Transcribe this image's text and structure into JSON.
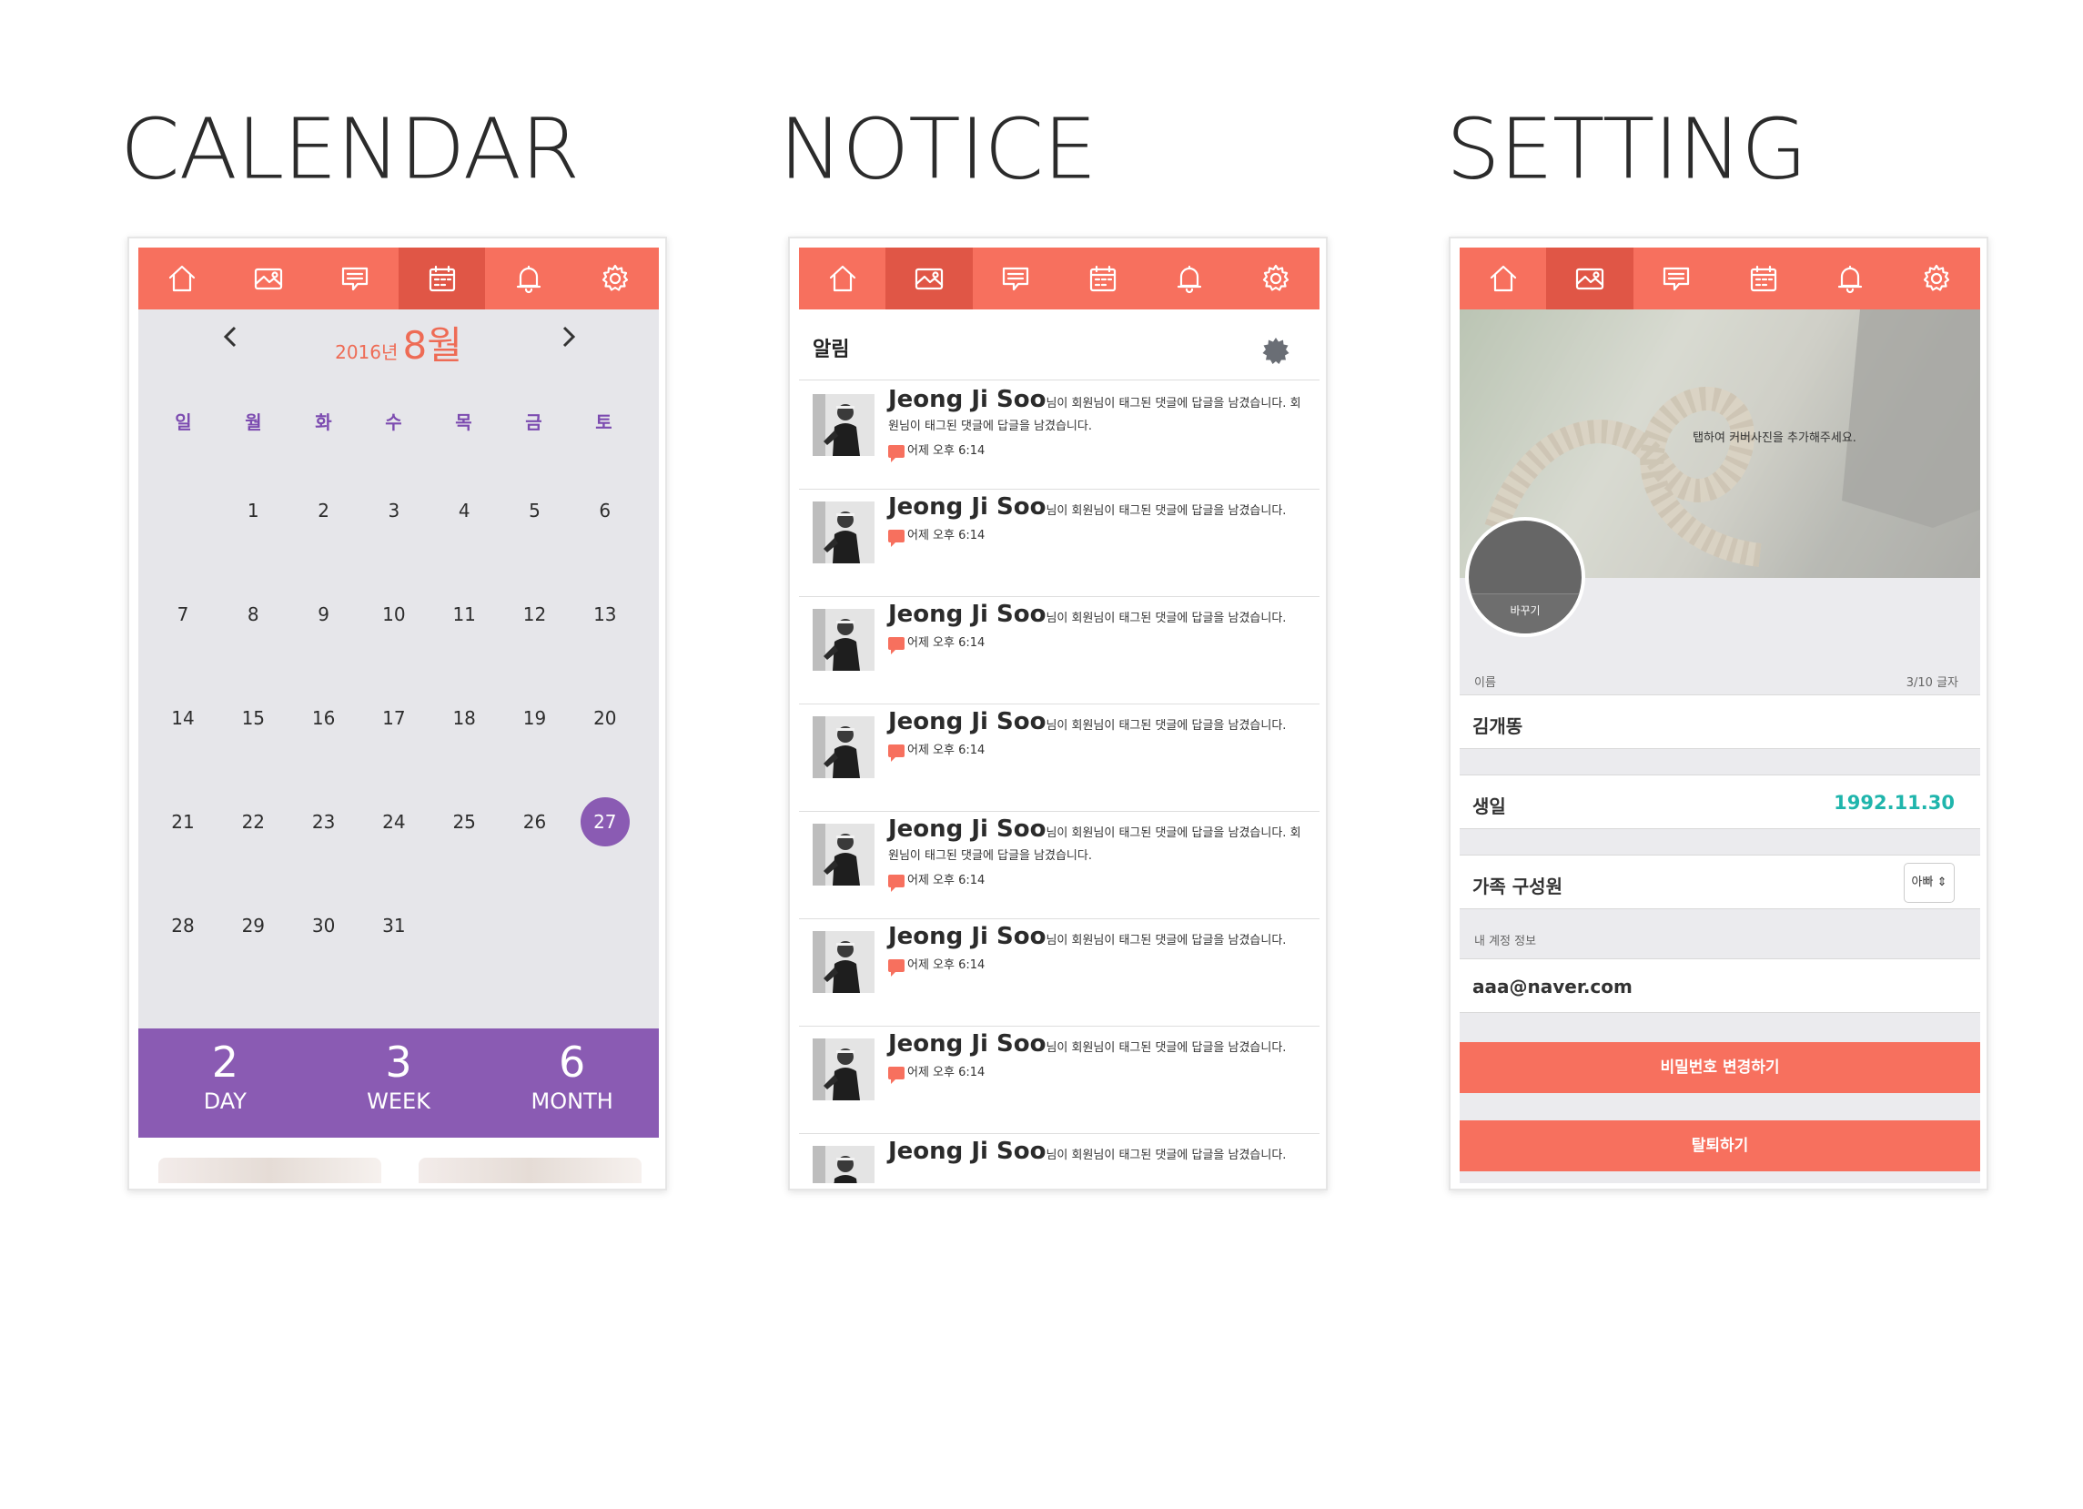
{
  "sections": {
    "calendar_title": "CALENDAR",
    "notice_title": "NOTICE",
    "setting_title": "SETTING"
  },
  "nav_icons": [
    "home-icon",
    "photo-icon",
    "chat-icon",
    "calendar-icon",
    "bell-icon",
    "gear-icon"
  ],
  "colors": {
    "accent": "#f7705e",
    "accent_active": "#e05646",
    "purple": "#8a5bb3",
    "teal": "#1fb5ac"
  },
  "calendar": {
    "year_label": "2016년",
    "month_label": "8월",
    "weekdays": [
      "일",
      "월",
      "화",
      "수",
      "목",
      "금",
      "토"
    ],
    "first_weekday": 1,
    "days_in_month": 31,
    "today": 27,
    "stats": [
      {
        "value": "2",
        "label": "DAY"
      },
      {
        "value": "3",
        "label": "WEEK"
      },
      {
        "value": "6",
        "label": "MONTH"
      }
    ]
  },
  "notice": {
    "title": "알림",
    "items": [
      {
        "name": "Jeong Ji Soo",
        "message": "님이 회원님이 태그된 댓글에 답글을 남겼습니다. 회원님이 태그된 댓글에 답글을 남겼습니다.",
        "time": "어제 오후 6:14"
      },
      {
        "name": "Jeong Ji Soo",
        "message": "님이 회원님이 태그된 댓글에 답글을 남겼습니다.",
        "time": "어제 오후 6:14"
      },
      {
        "name": "Jeong Ji Soo",
        "message": "님이 회원님이 태그된 댓글에 답글을 남겼습니다.",
        "time": "어제 오후 6:14"
      },
      {
        "name": "Jeong Ji Soo",
        "message": "님이 회원님이 태그된 댓글에 답글을 남겼습니다.",
        "time": "어제 오후 6:14"
      },
      {
        "name": "Jeong Ji Soo",
        "message": "님이 회원님이 태그된 댓글에 답글을 남겼습니다. 회원님이 태그된 댓글에 답글을 남겼습니다.",
        "time": "어제 오후 6:14"
      },
      {
        "name": "Jeong Ji Soo",
        "message": "님이 회원님이 태그된 댓글에 답글을 남겼습니다.",
        "time": "어제 오후 6:14"
      },
      {
        "name": "Jeong Ji Soo",
        "message": "님이 회원님이 태그된 댓글에 답글을 남겼습니다.",
        "time": "어제 오후 6:14"
      },
      {
        "name": "Jeong Ji Soo",
        "message": "님이 회원님이 태그된 댓글에 답글을 남겼습니다.",
        "time": ""
      }
    ]
  },
  "setting": {
    "cover_hint": "탭하여 커버사진을 추가해주세요.",
    "avatar_change": "바꾸기",
    "name_label": "이름",
    "name_counter": "3/10 글자",
    "name_value": "김개똥",
    "birthday_label": "생일",
    "birthday_value": "1992.11.30",
    "family_label": "가족 구성원",
    "family_value": "아빠 ⇕",
    "account_label": "내 계정 정보",
    "email_value": "aaa@naver.com",
    "change_password": "비밀번호 변경하기",
    "withdraw": "탈퇴하기"
  }
}
